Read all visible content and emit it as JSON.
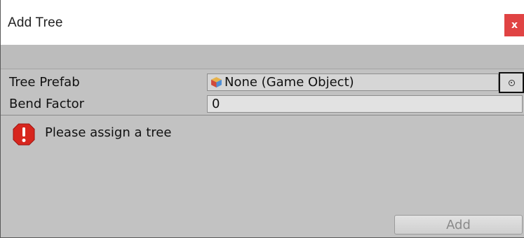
{
  "window": {
    "title": "Add Tree",
    "close_label": "x"
  },
  "fields": {
    "tree_prefab": {
      "label": "Tree Prefab",
      "value": "None (Game Object)"
    },
    "bend_factor": {
      "label": "Bend Factor",
      "value": "0"
    }
  },
  "help": {
    "message": "Please assign a tree",
    "icon": "error-icon"
  },
  "actions": {
    "add_label": "Add",
    "add_enabled": false
  },
  "colors": {
    "error_red": "#d7261e",
    "close_red": "#e04343"
  }
}
